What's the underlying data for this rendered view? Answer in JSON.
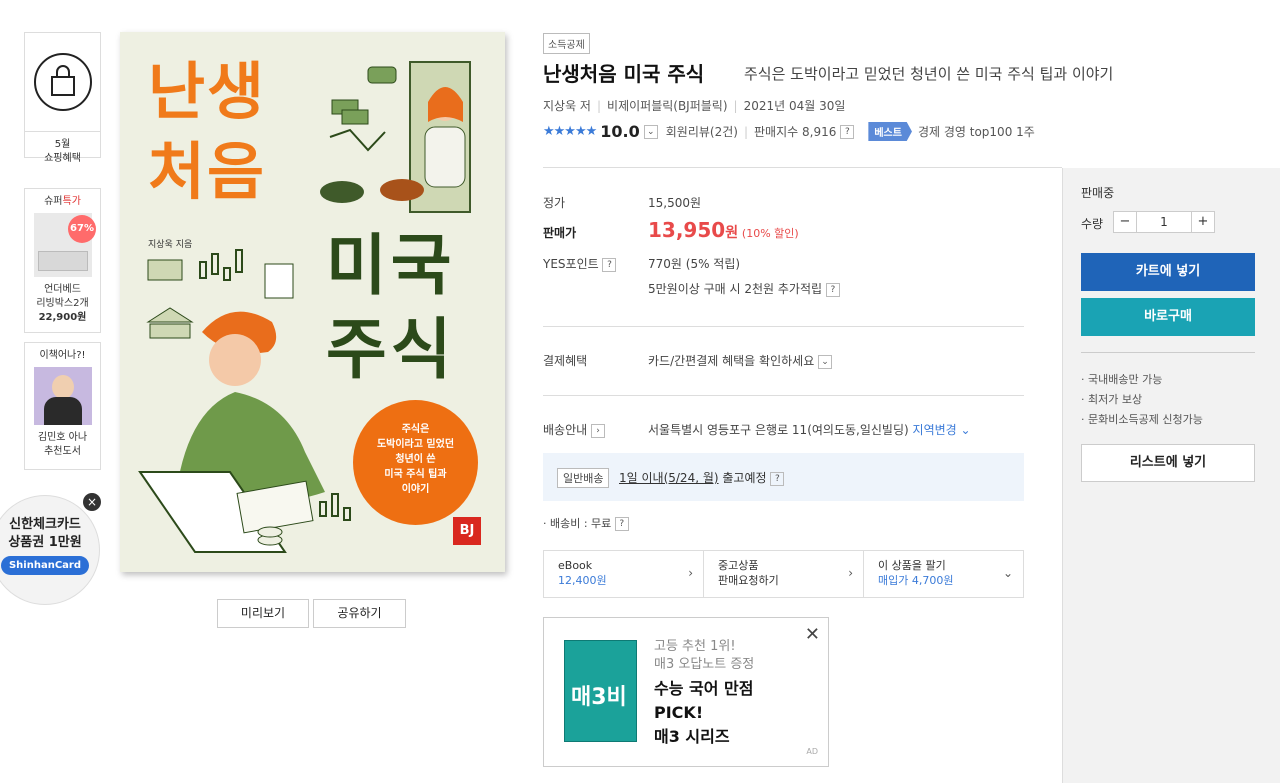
{
  "rail": {
    "month_label": "5월",
    "benefit_label": "쇼핑혜택",
    "super_sale_prefix": "슈퍼",
    "super_sale_suffix": "특가",
    "discount_badge": "67%",
    "product_name_1": "언더베드",
    "product_name_2": "리빙박스2개",
    "product_price": "22,900원",
    "recommend_title": "이책어나?!",
    "recommend_line1": "김민호 아나",
    "recommend_line2": "추천도서"
  },
  "shinhan": {
    "line1": "신한체크카드",
    "line2": "상품권 1만원",
    "card_label": "ShinhanCard",
    "close_label": "×"
  },
  "cover": {
    "title_line1": "난생",
    "title_line2": "처음",
    "title_line3": "미국",
    "title_line4": "주식",
    "author": "지상욱 지음",
    "badge_line1": "주식은",
    "badge_line2": "도박이라고 믿었던",
    "badge_line3": "청년이 쓴",
    "badge_line4": "미국 주식 팁과",
    "badge_line5": "이야기",
    "publisher_mark": "BJ"
  },
  "cover_buttons": {
    "preview": "미리보기",
    "share": "공유하기"
  },
  "product": {
    "tag": "소득공제",
    "title": "난생처음 미국 주식",
    "subtitle": "주식은 도박이라고 믿었던 청년이 쓴 미국 주식 팁과 이야기",
    "author": "지상욱 저",
    "publisher": "비제이퍼블릭(BJ퍼블릭)",
    "date": "2021년 04월 30일",
    "stars": "★★★★★",
    "score": "10.0",
    "reviews": "회원리뷰(2건)",
    "sales_index": "판매지수 8,916",
    "best_label": "베스트",
    "best_rank": "경제 경영 top100 1주"
  },
  "pricing": {
    "list_price_label": "정가",
    "list_price": "15,500원",
    "sale_price_label": "판매가",
    "sale_price": "13,950",
    "sale_unit": "원",
    "discount": "(10% 할인)",
    "points_label": "YES포인트",
    "points": "770원 (5% 적립)",
    "points_extra": "5만원이상 구매 시 2천원 추가적립",
    "payment_label": "결제혜택",
    "payment_value": "카드/간편결제 혜택을 확인하세요",
    "delivery_label": "배송안내",
    "delivery_address": "서울특별시 영등포구 은행로 11(여의도동,일신빌딩)",
    "delivery_change": "지역변경",
    "shipping_type": "일반배송",
    "shipping_eta": "1일 이내(5/24, 월)",
    "shipping_suffix": "출고예정",
    "shipping_fee": "· 배송비 : 무료"
  },
  "alternatives": [
    {
      "title": "eBook",
      "value": "12,400원"
    },
    {
      "title": "중고상품",
      "value": "판매요청하기"
    },
    {
      "title": "이 상품을 팔기",
      "value": "매입가 4,700원"
    }
  ],
  "ad": {
    "line1": "고등 추천 1위!",
    "line2": "매3 오답노트 증정",
    "head1": "수능 국어 만점",
    "head2": "PICK!",
    "head3": "매3 시리즈",
    "book_text": "매3비",
    "ad_mark": "AD",
    "close": "✕"
  },
  "panel": {
    "status": "판매중",
    "qty_label": "수량",
    "qty_minus": "−",
    "qty_value": "1",
    "qty_plus": "+",
    "cart_button": "카트에 넣기",
    "buy_button": "바로구매",
    "notes": [
      "· 국내배송만 가능",
      "· 최저가 보상",
      "· 문화비소득공제 신청가능"
    ],
    "wishlist_button": "리스트에 넣기"
  },
  "colors": {
    "accent_blue": "#1f64b8",
    "teal": "#1aa3b4",
    "price_red": "#e84a4a",
    "cover_orange": "#f07a1a",
    "cover_green": "#2c4a1a"
  }
}
